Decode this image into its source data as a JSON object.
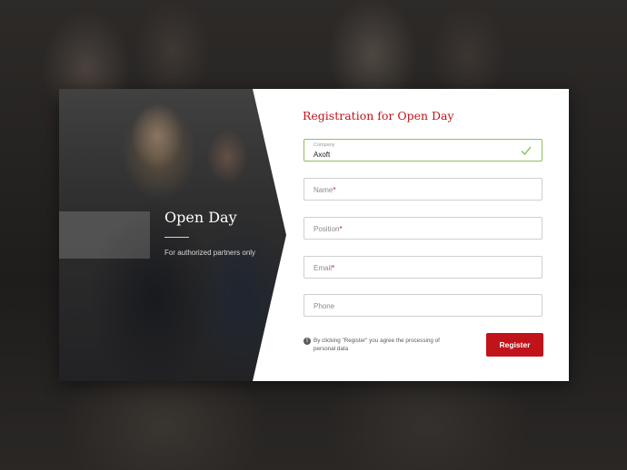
{
  "hero": {
    "title": "Open Day",
    "subtitle": "For authorized partners only"
  },
  "form": {
    "title": "Registration for Open Day",
    "fields": [
      {
        "label": "Company",
        "value": "Axoft",
        "state": "valid"
      },
      {
        "placeholder": "Name",
        "required": true
      },
      {
        "placeholder": "Position",
        "required": true
      },
      {
        "placeholder": "Email",
        "required": true
      },
      {
        "placeholder": "Phone",
        "required": false
      }
    ],
    "required_marker": "*",
    "notice_icon": "!",
    "notice": "By clicking \"Register\" you agree the processing of personal data",
    "submit_label": "Register"
  },
  "colors": {
    "accent": "#c0131a",
    "valid": "#8cc15a"
  }
}
